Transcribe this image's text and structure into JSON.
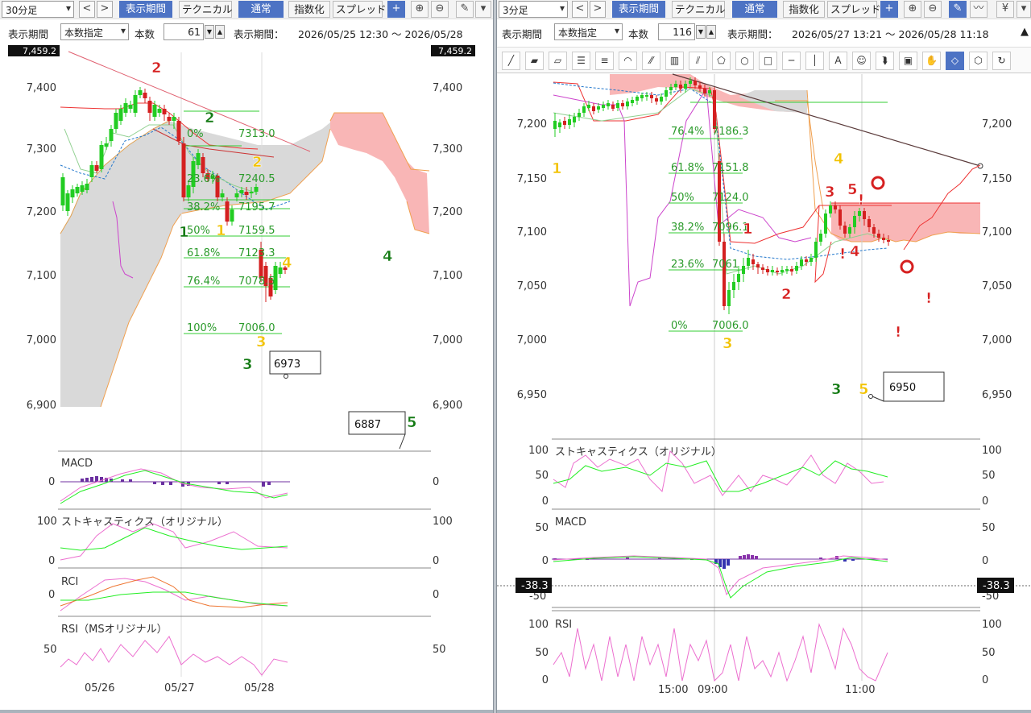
{
  "left": {
    "toolbar": {
      "timeframe": "30分足",
      "prev": "<",
      "next": ">",
      "period_btn": "表示期間",
      "tech_btn": "テクニカル",
      "normal_btn": "通常",
      "index_btn": "指数化",
      "spread_btn": "スプレッド",
      "plus": "+",
      "zoom_in": "⊕",
      "zoom_out": "⊖",
      "pen": "✎"
    },
    "period": {
      "label": "表示期間",
      "mode": "本数指定",
      "count_label": "本数",
      "count": "61",
      "range_label": "表示期間：",
      "range": "2026/05/25 12:30 ～ 2026/05/28"
    },
    "price_axis": [
      "7,400",
      "7,300",
      "7,200",
      "7,100",
      "7,000",
      "6,900"
    ],
    "top_price": "7,459.2",
    "fib": [
      {
        "l": "0%",
        "v": "7313.0"
      },
      {
        "l": "23.6%",
        "v": "7240.5"
      },
      {
        "l": "38.2%",
        "v": "7195.7"
      },
      {
        "l": "50%",
        "v": "7159.5"
      },
      {
        "l": "61.8%",
        "v": "7123.3"
      },
      {
        "l": "76.4%",
        "v": "7078.5"
      },
      {
        "l": "100%",
        "v": "7006.0"
      }
    ],
    "callouts": [
      "6973",
      "6887"
    ],
    "waves": {
      "red2": "2",
      "g2": "2",
      "y2": "2",
      "g1": "1",
      "y1": "1",
      "y4": "4",
      "g4": "4",
      "y3": "3",
      "g3": "3",
      "g5": "5"
    },
    "macd": {
      "title": "MACD",
      "axis": "0"
    },
    "stoch": {
      "title": "ストキャスティクス（オリジナル）",
      "axis_top": "100",
      "axis_mid": "0"
    },
    "rci": {
      "title": "RCI",
      "axis": "0"
    },
    "rsi": {
      "title": "RSI（MSオリジナル）",
      "axis": "50"
    },
    "dates": [
      "05/26",
      "05/27",
      "05/28"
    ]
  },
  "right": {
    "toolbar": {
      "timeframe": "3分足",
      "prev": "<",
      "next": ">",
      "period_btn": "表示期間",
      "tech_btn": "テクニカル",
      "normal_btn": "通常",
      "index_btn": "指数化",
      "spread_btn": "スプレッド",
      "plus": "+",
      "zoom_in": "⊕",
      "zoom_out": "⊖",
      "pen": "✎",
      "wave": "〰",
      "yen": "¥",
      "more": "▾"
    },
    "period": {
      "label": "表示期間",
      "mode": "本数指定",
      "count_label": "本数",
      "count": "116",
      "range_label": "表示期間：",
      "range": "2026/05/27 13:21 ～ 2026/05/28 11:18"
    },
    "drawing_tools": [
      "╱",
      "▰",
      "▱",
      "☰",
      "≡",
      "◠",
      "⁄⁄",
      "▥",
      "⫽",
      "⬠",
      "○",
      "□",
      "─",
      "│",
      "A",
      "☺",
      "⮯",
      "▣",
      "✋",
      "◇",
      "⬡",
      "↻"
    ],
    "drawing_tool_labels": {
      "icon": "icon"
    },
    "price_axis_right": [
      "7,200",
      "7,150",
      "7,100",
      "7,050",
      "7,000",
      "6,950"
    ],
    "price_axis_left": [
      "7,200",
      "7,150",
      "7,100",
      "7,050",
      "7,000",
      "6,950"
    ],
    "fib": [
      {
        "l": "76.4%",
        "v": "7186.3"
      },
      {
        "l": "61.8%",
        "v": "7151.8"
      },
      {
        "l": "50%",
        "v": "7124.0"
      },
      {
        "l": "38.2%",
        "v": "7096.1"
      },
      {
        "l": "23.6%",
        "v": "7061"
      },
      {
        "l": "0%",
        "v": "7006.0"
      }
    ],
    "callouts": [
      "6950"
    ],
    "waves": {
      "y1": "1",
      "r1": "1",
      "y4": "4",
      "r3": "3",
      "r5": "5",
      "ex": "!",
      "r4": "4",
      "r2": "2",
      "y3": "3",
      "g3": "3",
      "y5": "5"
    },
    "stoch": {
      "title": "ストキャスティクス（オリジナル）",
      "a100": "100",
      "a50": "50",
      "a0": "0"
    },
    "macd": {
      "title": "MACD",
      "a50": "50",
      "a0": "0",
      "a-50": "-50",
      "badge": "-38.3"
    },
    "rsi": {
      "title": "RSI",
      "a100": "100",
      "a50": "50",
      "a0": "0"
    },
    "times": [
      "15:00",
      "09:00",
      "11:00"
    ]
  }
}
